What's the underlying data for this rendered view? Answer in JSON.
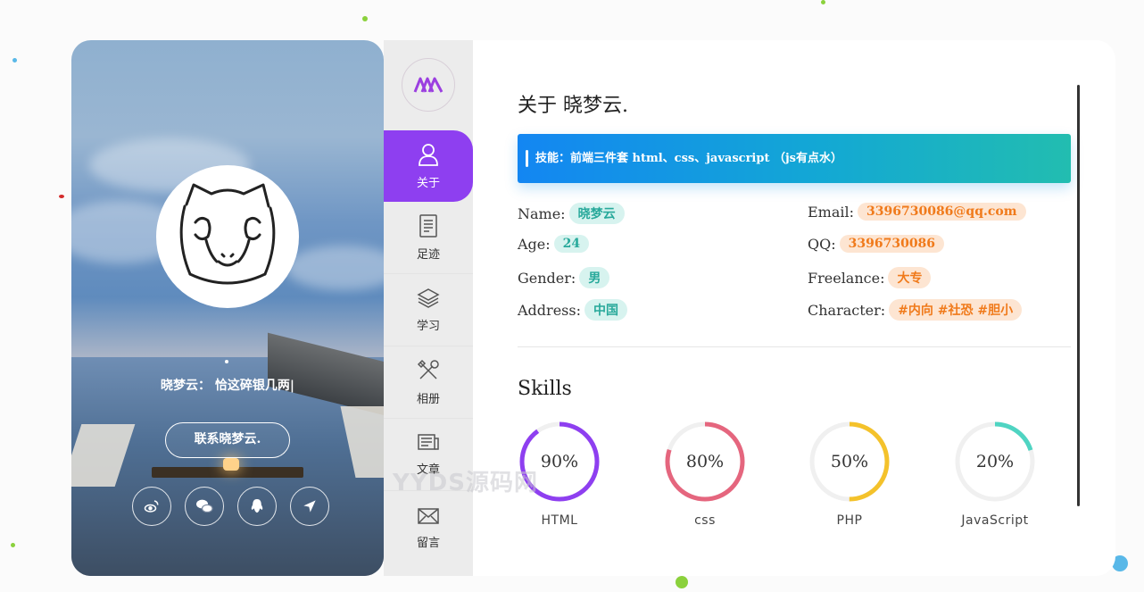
{
  "profile": {
    "intro_text": "晓梦云： 恰这碎银几两|",
    "contact_button": "联系晓梦云."
  },
  "socials": [
    {
      "icon": "weibo-icon"
    },
    {
      "icon": "wechat-icon"
    },
    {
      "icon": "qq-icon"
    },
    {
      "icon": "location-arrow-icon"
    }
  ],
  "nav": {
    "items": [
      {
        "label": "关于",
        "icon": "user-icon",
        "active": true
      },
      {
        "label": "足迹",
        "icon": "document-icon"
      },
      {
        "label": "学习",
        "icon": "layers-icon"
      },
      {
        "label": "相册",
        "icon": "tools-icon"
      },
      {
        "label": "文章",
        "icon": "article-icon"
      },
      {
        "label": "留言",
        "icon": "mail-icon"
      }
    ]
  },
  "about": {
    "title": "关于 晓梦云.",
    "skills_banner": "技能：前端三件套 html、css、javascript （js有点水）",
    "left": [
      {
        "key": "Name:",
        "value": "晓梦云"
      },
      {
        "key": "Age:",
        "value": "24"
      },
      {
        "key": "Gender:",
        "value": "男"
      },
      {
        "key": "Address:",
        "value": "中国"
      }
    ],
    "right": [
      {
        "key": "Email:",
        "value": "3396730086@qq.com"
      },
      {
        "key": "QQ:",
        "value": "3396730086"
      },
      {
        "key": "Freelance:",
        "value": "大专"
      },
      {
        "key": "Character:",
        "value": "#内向 #社恐 #胆小"
      }
    ]
  },
  "skills": {
    "title": "Skills",
    "items": [
      {
        "name": "HTML",
        "percent": 90,
        "label": "90%",
        "color": "#8e3ff0"
      },
      {
        "name": "css",
        "percent": 80,
        "label": "80%",
        "color": "#e5667e"
      },
      {
        "name": "PHP",
        "percent": 50,
        "label": "50%",
        "color": "#f4c22b"
      },
      {
        "name": "JavaScript",
        "percent": 20,
        "label": "20%",
        "color": "#4fd4c2"
      }
    ]
  },
  "watermark": "YYDS源码网"
}
